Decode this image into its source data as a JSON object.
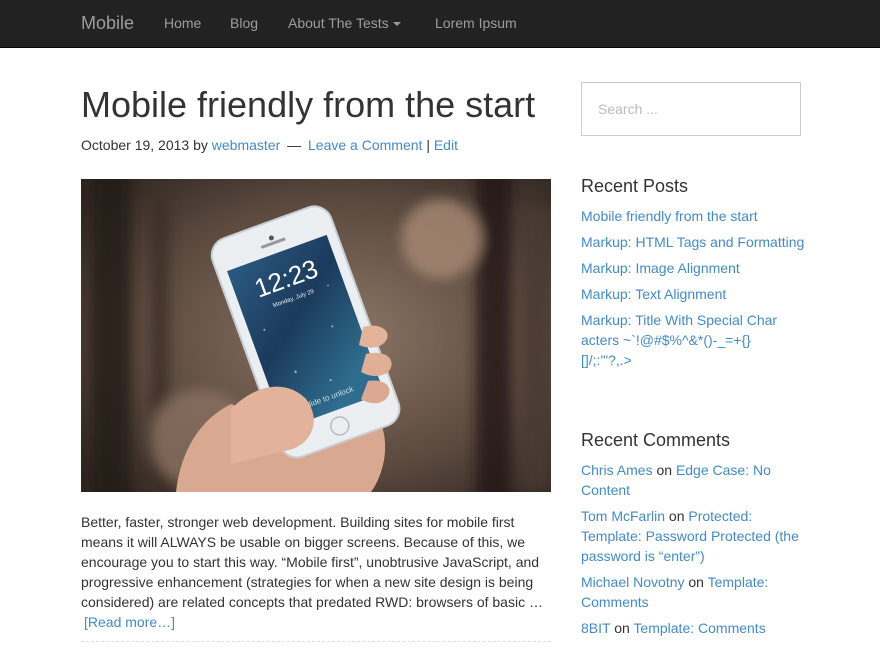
{
  "nav": {
    "brand": "Mobile",
    "items": [
      "Home",
      "Blog",
      "About The Tests",
      "Lorem Ipsum"
    ]
  },
  "post": {
    "title": "Mobile friendly from the start",
    "date": "October 19, 2013",
    "by": "by",
    "author": "webmaster",
    "dash": "—",
    "comment_link": "Leave a Comment",
    "sep": "|",
    "edit_link": "Edit",
    "excerpt": "Better, faster, stronger web development. Building sites for mobile first means it will ALWAYS be usable on bigger screens. Because of this, we encourage you to start this way. “Mobile first”, unobtrusive JavaScript, and progressive enhancement (strategies for when a new site design is being considered) are related concepts that predated RWD: browsers of basic …",
    "read_more": "[Read more…]",
    "phone_time": "12:23",
    "phone_date": "Monday, July 29",
    "phone_unlock": "slide to unlock"
  },
  "sidebar": {
    "search_placeholder": "Search ...",
    "recent_posts_title": "Recent Posts",
    "recent_posts": [
      "Mobile friendly from the start",
      "Markup: HTML Tags and Formatting",
      "Markup: Image Alignment",
      "Markup: Text Alignment",
      "Markup: Title With Special Characters ~`!@#$%^&*()-_=+{}[]/;:'\"?,.>"
    ],
    "recent_comments_title": "Recent Comments",
    "on": "on",
    "recent_comments": [
      {
        "author": "Chris Ames",
        "post": "Edge Case: No Content"
      },
      {
        "author": "Tom McFarlin",
        "post": "Protected: Template: Password Protected (the password is “enter”)"
      },
      {
        "author": "Michael Novotny",
        "post": "Template: Comments"
      },
      {
        "author": "8BIT",
        "post": "Template: Comments"
      }
    ]
  },
  "colors": {
    "navbar_bg": "#222222",
    "nav_text": "#9d9d9d",
    "link": "#428bca",
    "body_text": "#333333"
  }
}
